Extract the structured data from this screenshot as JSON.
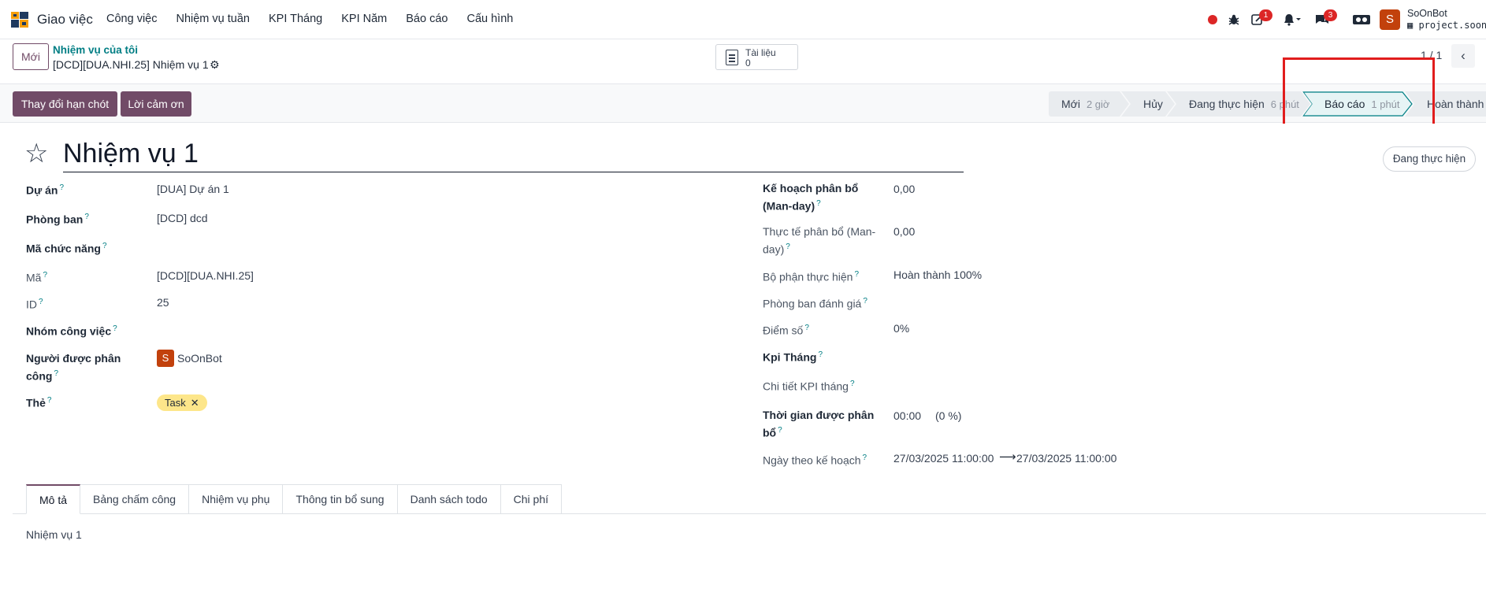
{
  "navbar": {
    "app_name": "Giao việc",
    "menu": [
      "Công việc",
      "Nhiệm vụ tuần",
      "KPI Tháng",
      "KPI Năm",
      "Báo cáo",
      "Cấu hình"
    ],
    "activity_badge": "1",
    "messages_badge": "3",
    "user_initial": "S",
    "user_name": "SoOnBot",
    "user_db": "project.soon."
  },
  "control": {
    "new_label": "Mới",
    "breadcrumb_parent": "Nhiệm vụ của tôi",
    "breadcrumb_current": "[DCD][DUA.NHI.25] Nhiệm vụ 1",
    "docs_label": "Tài liệu",
    "docs_count": "0",
    "pager": "1 / 1"
  },
  "actions": {
    "change_deadline": "Thay đổi hạn chót",
    "thanks": "Lời cảm ơn"
  },
  "stages": [
    {
      "name": "Mới",
      "duration": "2 giờ"
    },
    {
      "name": "Hủy",
      "duration": ""
    },
    {
      "name": "Đang thực hiện",
      "duration": "6 phút"
    },
    {
      "name": "Báo cáo",
      "duration": "1 phút"
    },
    {
      "name": "Hoàn thành",
      "duration": ""
    }
  ],
  "form": {
    "title": "Nhiệm vụ 1",
    "status_pill": "Đang thực hiện",
    "left": {
      "project_label": "Dự án",
      "project_value": "[DUA] Dự án 1",
      "dept_label": "Phòng ban",
      "dept_value": "[DCD] dcd",
      "func_code_label": "Mã chức năng",
      "code_label": "Mã",
      "code_value": "[DCD][DUA.NHI.25]",
      "id_label": "ID",
      "id_value": "25",
      "group_label": "Nhóm công việc",
      "assignee_label_1": "Người được phân",
      "assignee_label_2": "công",
      "assignee_initial": "S",
      "assignee_value": "SoOnBot",
      "tag_label": "Thẻ",
      "tag_value": "Task"
    },
    "right": {
      "plan_label_1": "Kế hoạch phân bổ",
      "plan_label_2": "(Man-day)",
      "plan_value": "0,00",
      "actual_label_1": "Thực tế phân bổ (Man-",
      "actual_label_2": "day)",
      "actual_value": "0,00",
      "unit_label": "Bộ phận thực hiện",
      "unit_value": "Hoàn thành 100%",
      "eval_dept_label": "Phòng ban đánh giá",
      "score_label": "Điểm số",
      "score_value": "0%",
      "kpi_month_label": "Kpi Tháng",
      "kpi_detail_label": "Chi tiết KPI tháng",
      "alloc_time_label_1": "Thời gian được phân",
      "alloc_time_label_2": "bổ",
      "alloc_time_value": "00:00",
      "alloc_time_pct": "(0 %)",
      "plan_date_label": "Ngày theo kế hoạch",
      "plan_date_start": "27/03/2025 11:00:00",
      "plan_date_end": "27/03/2025 11:00:00"
    }
  },
  "tabs": [
    "Mô tả",
    "Bảng chấm công",
    "Nhiệm vụ phụ",
    "Thông tin bổ sung",
    "Danh sách todo",
    "Chi phí"
  ],
  "description": "Nhiệm vụ 1",
  "colors": {
    "brand": "#714b67",
    "accent": "#017e84",
    "highlight": "#e11d1d"
  }
}
